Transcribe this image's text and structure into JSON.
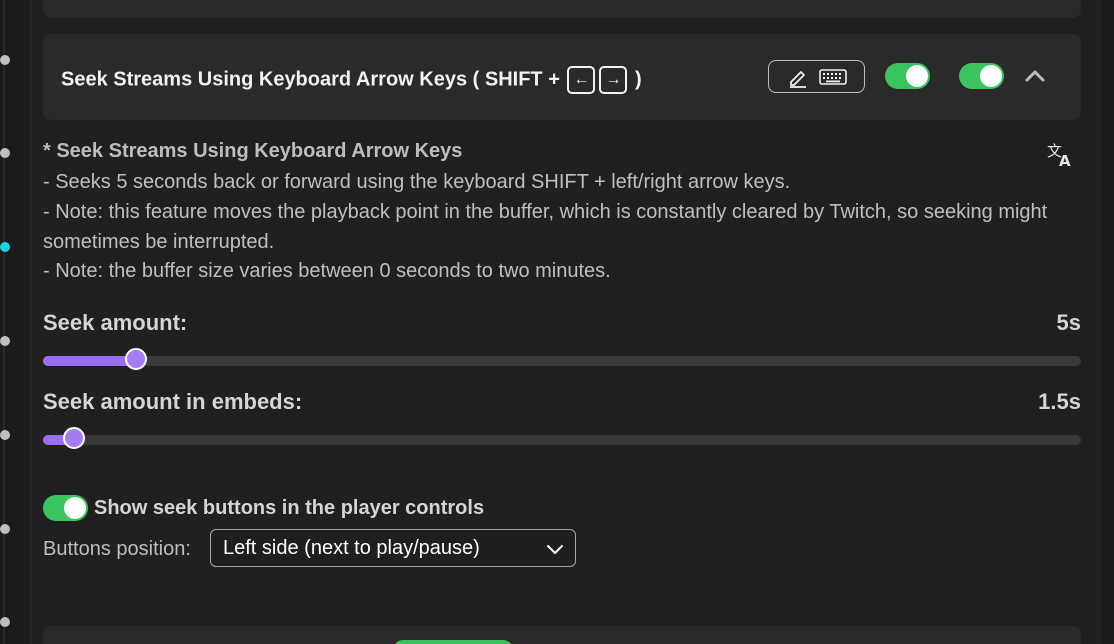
{
  "header": {
    "title_prefix": "Seek Streams Using Keyboard Arrow Keys ( SHIFT +",
    "key_left": "←",
    "key_right": "→",
    "title_suffix": ")",
    "shortcut_button_icons": [
      "pencil-icon",
      "keyboard-icon"
    ],
    "toggle_1": true,
    "toggle_2": true
  },
  "description": {
    "title": "* Seek Streams Using Keyboard Arrow Keys",
    "lines": [
      "- Seeks 5 seconds back or forward using the keyboard SHIFT + left/right arrow keys.",
      "- Note: this feature moves the playback point in the buffer, which is constantly cleared by Twitch, so seeking might sometimes be interrupted.",
      "- Note: the buffer size varies between 0 seconds to two minutes."
    ]
  },
  "settings": {
    "seek_amount": {
      "label": "Seek amount:",
      "value": "5s",
      "fraction": 0.09
    },
    "seek_amount_embeds": {
      "label": "Seek amount in embeds:",
      "value": "1.5s",
      "fraction": 0.03
    },
    "show_seek_buttons": {
      "label": "Show seek buttons in the player controls",
      "enabled": true
    },
    "buttons_position": {
      "label": "Buttons position:",
      "selected": "Left side (next to play/pause)"
    }
  },
  "colors": {
    "accent_green": "#3ac45d",
    "accent_purple": "#9b6ef0",
    "timeline_active": "#19d4e8"
  }
}
